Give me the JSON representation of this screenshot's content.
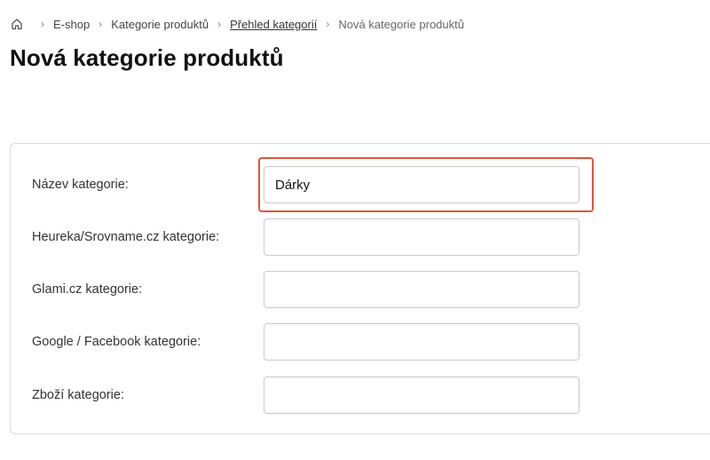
{
  "breadcrumb": {
    "home_icon": "home-icon",
    "items": [
      "E-shop",
      "Kategorie produktů",
      "Přehled kategorií",
      "Nová kategorie produktů"
    ]
  },
  "page": {
    "title": "Nová kategorie produktů"
  },
  "form": {
    "fields": [
      {
        "label": "Název kategorie:",
        "value": "Dárky"
      },
      {
        "label": "Heureka/Srovname.cz kategorie:",
        "value": ""
      },
      {
        "label": "Glami.cz kategorie:",
        "value": ""
      },
      {
        "label": "Google / Facebook kategorie:",
        "value": ""
      },
      {
        "label": "Zboží kategorie:",
        "value": ""
      }
    ],
    "highlight_color": "#e2553a"
  }
}
